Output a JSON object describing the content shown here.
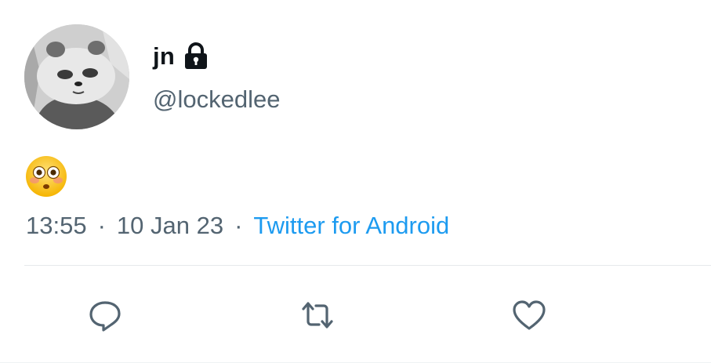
{
  "user": {
    "display_name": "jn",
    "handle": "@lockedlee",
    "avatar_icon": "panda-avatar",
    "protected_icon": "lock-icon"
  },
  "tweet": {
    "emoji": "flushed-face-emoji",
    "timestamp_time": "13:55",
    "timestamp_date": "10 Jan 23",
    "separator": "·",
    "source": "Twitter for Android"
  },
  "actions": {
    "reply_icon": "reply-icon",
    "retweet_icon": "retweet-icon",
    "like_icon": "heart-icon"
  },
  "colors": {
    "text_primary": "#0f1419",
    "text_secondary": "#536471",
    "accent": "#1d9bf0",
    "divider": "#e6e9eb"
  }
}
